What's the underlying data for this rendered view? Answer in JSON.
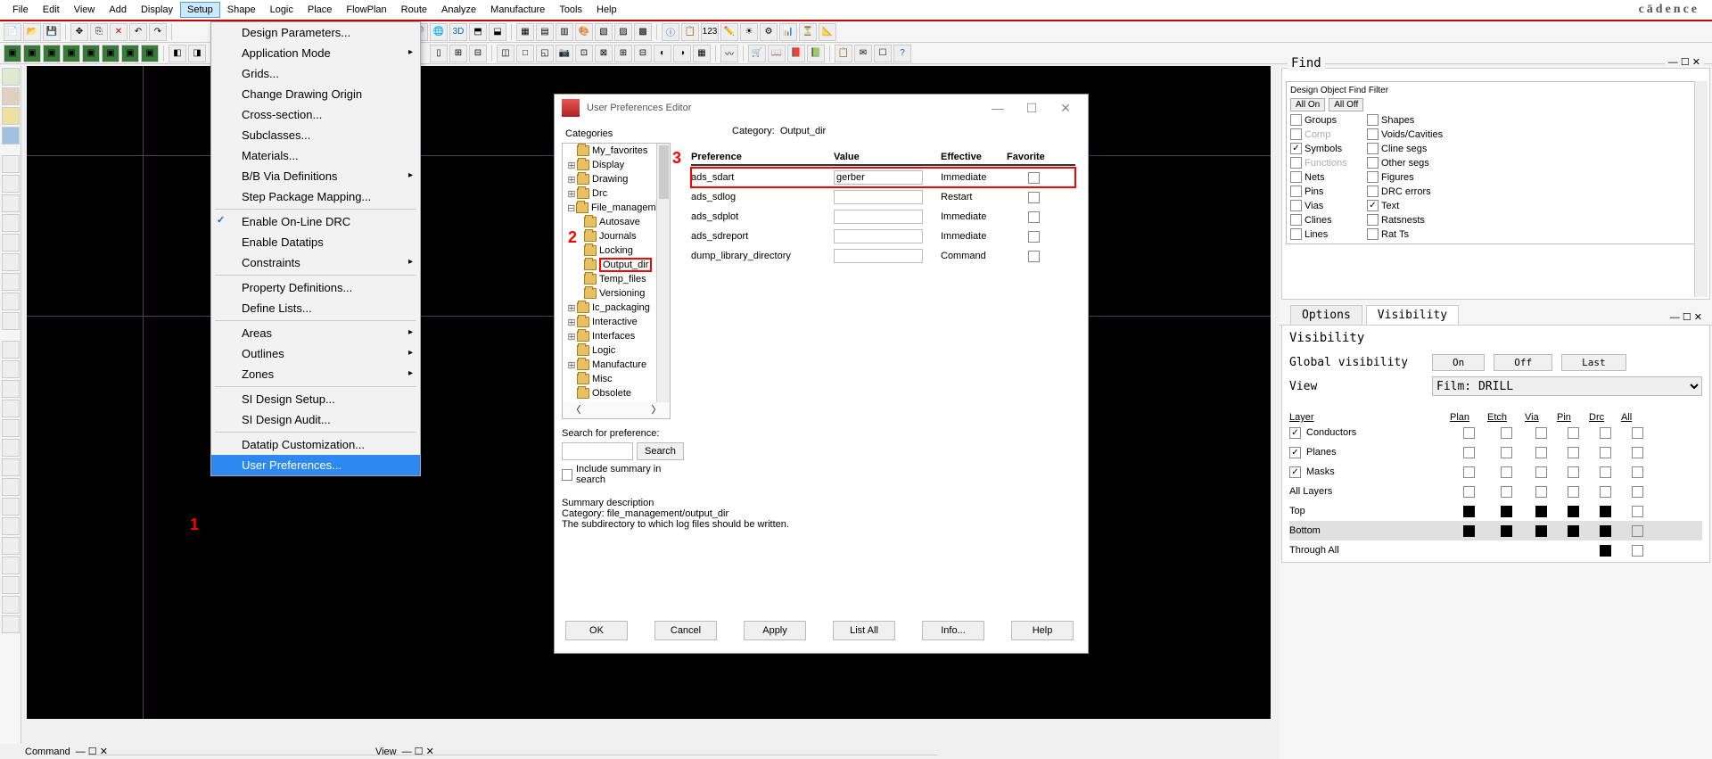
{
  "menubar": [
    "File",
    "Edit",
    "View",
    "Add",
    "Display",
    "Setup",
    "Shape",
    "Logic",
    "Place",
    "FlowPlan",
    "Route",
    "Analyze",
    "Manufacture",
    "Tools",
    "Help"
  ],
  "menubar_active": 5,
  "logo": "cādence",
  "setup_menu": {
    "groups": [
      [
        {
          "t": "Design Parameters...",
          "i": "gear"
        },
        {
          "t": "Application Mode",
          "sub": true
        },
        {
          "t": "Grids..."
        },
        {
          "t": "Change Drawing Origin"
        },
        {
          "t": "Cross-section...",
          "i": "layers"
        },
        {
          "t": "Subclasses..."
        },
        {
          "t": "Materials..."
        },
        {
          "t": "B/B Via Definitions",
          "sub": true
        },
        {
          "t": "Step Package Mapping..."
        }
      ],
      [
        {
          "t": "Enable On-Line DRC",
          "i": "check"
        },
        {
          "t": "Enable Datatips",
          "i": "tip"
        },
        {
          "t": "Constraints",
          "sub": true
        }
      ],
      [
        {
          "t": "Property Definitions..."
        },
        {
          "t": "Define Lists..."
        }
      ],
      [
        {
          "t": "Areas",
          "sub": true
        },
        {
          "t": "Outlines",
          "sub": true
        },
        {
          "t": "Zones",
          "sub": true
        }
      ],
      [
        {
          "t": "SI Design Setup..."
        },
        {
          "t": "SI Design Audit...",
          "i": "si"
        }
      ],
      [
        {
          "t": "Datatip Customization..."
        },
        {
          "t": "User Preferences...",
          "hl": true
        }
      ]
    ]
  },
  "dialog": {
    "title": "User Preferences Editor",
    "cats_label": "Categories",
    "cat_label": "Category:",
    "cat_current": "Output_dir",
    "tree": [
      {
        "l": 1,
        "t": "My_favorites",
        "exp": ""
      },
      {
        "l": 1,
        "t": "Display",
        "exp": "+"
      },
      {
        "l": 1,
        "t": "Drawing",
        "exp": "+"
      },
      {
        "l": 1,
        "t": "Drc",
        "exp": "+"
      },
      {
        "l": 1,
        "t": "File_management",
        "exp": "-"
      },
      {
        "l": 2,
        "t": "Autosave",
        "exp": ""
      },
      {
        "l": 2,
        "t": "Journals",
        "exp": ""
      },
      {
        "l": 2,
        "t": "Locking",
        "exp": ""
      },
      {
        "l": 2,
        "t": "Output_dir",
        "exp": "",
        "sel": true
      },
      {
        "l": 2,
        "t": "Temp_files",
        "exp": ""
      },
      {
        "l": 2,
        "t": "Versioning",
        "exp": ""
      },
      {
        "l": 1,
        "t": "Ic_packaging",
        "exp": "+"
      },
      {
        "l": 1,
        "t": "Interactive",
        "exp": "+"
      },
      {
        "l": 1,
        "t": "Interfaces",
        "exp": "+"
      },
      {
        "l": 1,
        "t": "Logic",
        "exp": ""
      },
      {
        "l": 1,
        "t": "Manufacture",
        "exp": "+"
      },
      {
        "l": 1,
        "t": "Misc",
        "exp": ""
      },
      {
        "l": 1,
        "t": "Obsolete",
        "exp": ""
      }
    ],
    "pref_head": [
      "Preference",
      "Value",
      "Effective",
      "Favorite"
    ],
    "prefs": [
      {
        "n": "ads_sdart",
        "v": "gerber",
        "e": "Immediate",
        "hl": true
      },
      {
        "n": "ads_sdlog",
        "v": "",
        "e": "Restart"
      },
      {
        "n": "ads_sdplot",
        "v": "",
        "e": "Immediate"
      },
      {
        "n": "ads_sdreport",
        "v": "",
        "e": "Immediate"
      },
      {
        "n": "dump_library_directory",
        "v": "",
        "e": "Command"
      }
    ],
    "search_label": "Search for preference:",
    "search_btn": "Search",
    "inc_label": "Include summary in search",
    "summary_title": "Summary description",
    "summary_cat": "Category: file_management/output_dir",
    "summary_desc": "The subdirectory to which log files should be written.",
    "btns": [
      "OK",
      "Cancel",
      "Apply",
      "List All",
      "Info...",
      "Help"
    ]
  },
  "find": {
    "title": "Find",
    "inner_title": "Design Object Find Filter",
    "all_on": "All On",
    "all_off": "All Off",
    "rows": [
      [
        "Groups",
        false,
        "Shapes",
        false
      ],
      [
        "Comp",
        false,
        "Voids/Cavities",
        false
      ],
      [
        "Symbols",
        true,
        "Cline segs",
        false
      ],
      [
        "Functions",
        false,
        "Other segs",
        false
      ],
      [
        "Nets",
        false,
        "Figures",
        false
      ],
      [
        "Pins",
        false,
        "DRC errors",
        false
      ],
      [
        "Vias",
        false,
        "Text",
        true
      ],
      [
        "Clines",
        false,
        "Ratsnests",
        false
      ],
      [
        "Lines",
        false,
        "Rat Ts",
        false
      ]
    ]
  },
  "tabs": {
    "options": "Options",
    "visibility": "Visibility",
    "active": 1
  },
  "vis": {
    "title": "Visibility",
    "gv": "Global visibility",
    "on": "On",
    "off": "Off",
    "last": "Last",
    "view_label": "View",
    "view_val": "Film: DRILL",
    "layer_head": [
      "Layer",
      "Plan",
      "Etch",
      "Via",
      "Pin",
      "Drc",
      "All"
    ],
    "layers": [
      {
        "n": "Conductors",
        "ck": true,
        "cells": [
          "b",
          "b",
          "b",
          "b",
          "b",
          "b"
        ]
      },
      {
        "n": "Planes",
        "ck": true,
        "cells": [
          "b",
          "b",
          "b",
          "b",
          "b",
          "b"
        ]
      },
      {
        "n": "Masks",
        "ck": true,
        "cells": [
          "b",
          "b",
          "b",
          "b",
          "b",
          "b"
        ]
      },
      {
        "n": "All Layers",
        "ck": false,
        "cells": [
          "b",
          "b",
          "b",
          "b",
          "b",
          "b"
        ]
      },
      {
        "n": "Top",
        "ck": false,
        "cells": [
          "s",
          "s",
          "s",
          "s",
          "s",
          "b"
        ]
      },
      {
        "n": "Bottom",
        "ck": false,
        "cells": [
          "s",
          "s",
          "s",
          "s",
          "s",
          "b"
        ],
        "sel": true
      },
      {
        "n": "Through All",
        "ck": false,
        "cells": [
          "",
          "",
          "",
          "",
          "s",
          "b"
        ]
      }
    ]
  },
  "bottom": {
    "cmd": "Command",
    "view": "View"
  }
}
